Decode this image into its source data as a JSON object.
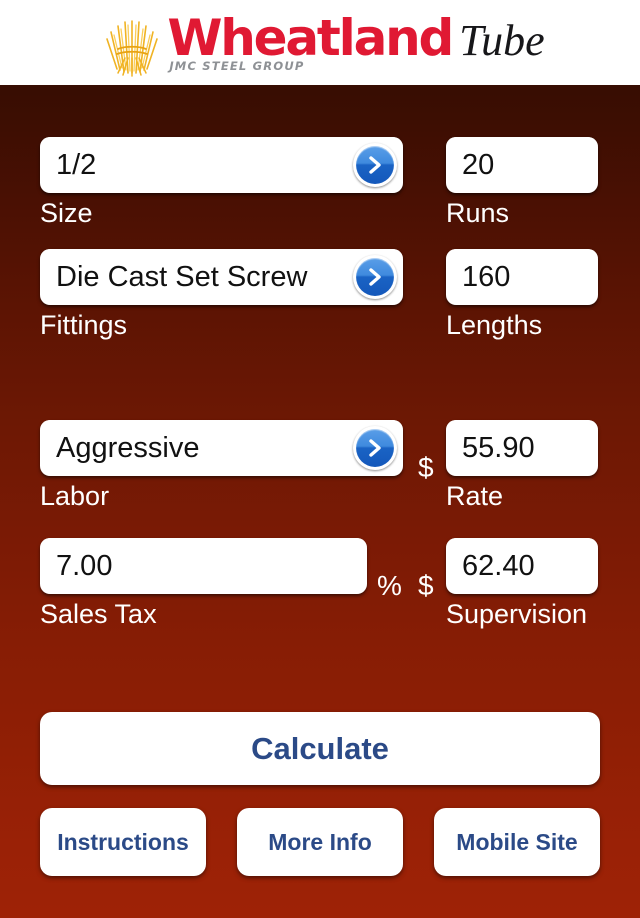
{
  "header": {
    "logo_icon": "wheat-sheaf-icon",
    "brand_primary": "Wheatland",
    "brand_secondary": "Tube",
    "tagline": "JMC STEEL GROUP",
    "brand_color": "#e01933",
    "tagline_color": "#8e9195",
    "background": "#ffffff"
  },
  "theme": {
    "background_top": "#2a0902",
    "background_bottom": "#9e2206",
    "button_text_color": "#2b4a87",
    "chevron_color": "#1a63c4"
  },
  "form": {
    "fields": [
      {
        "key": "size",
        "label": "Size",
        "value": "1/2",
        "has_chevron": true,
        "prefix": "",
        "suffix": ""
      },
      {
        "key": "runs",
        "label": "Runs",
        "value": "20",
        "has_chevron": false,
        "prefix": "",
        "suffix": ""
      },
      {
        "key": "fittings",
        "label": "Fittings",
        "value": "Die Cast Set Screw",
        "has_chevron": true,
        "prefix": "",
        "suffix": ""
      },
      {
        "key": "lengths",
        "label": "Lengths",
        "value": "160",
        "has_chevron": false,
        "prefix": "",
        "suffix": ""
      },
      {
        "key": "labor",
        "label": "Labor",
        "value": "Aggressive",
        "has_chevron": true,
        "prefix": "",
        "suffix": ""
      },
      {
        "key": "rate",
        "label": "Rate",
        "value": "55.90",
        "has_chevron": false,
        "prefix": "$",
        "suffix": ""
      },
      {
        "key": "sales_tax",
        "label": "Sales Tax",
        "value": "7.00",
        "has_chevron": false,
        "prefix": "",
        "suffix": "%"
      },
      {
        "key": "supervision",
        "label": "Supervision",
        "value": "62.40",
        "has_chevron": false,
        "prefix": "$",
        "suffix": ""
      }
    ]
  },
  "actions": {
    "calculate": "Calculate",
    "instructions": "Instructions",
    "more_info": "More Info",
    "mobile_site": "Mobile Site"
  }
}
